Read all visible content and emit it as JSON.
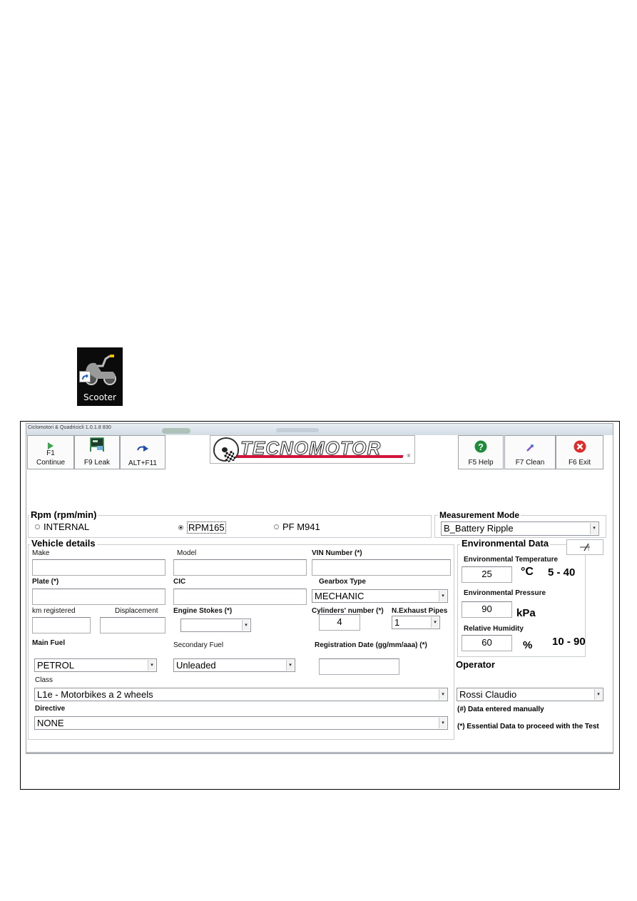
{
  "desktop": {
    "shortcut_label": "Scooter",
    "shortcut_icon": "scooter-icon"
  },
  "window": {
    "title": "Ciclomotori & Quadricicli 1.0.1.8  830"
  },
  "toolbar": {
    "continue": {
      "key": "F1",
      "label": "Continue",
      "icon": "play-icon"
    },
    "leak": {
      "label": "F9 Leak",
      "icon": "leak-test-icon"
    },
    "alt": {
      "label": "ALT+F11",
      "icon": "redo-arrow-icon"
    },
    "logo_text": "TECNOMOTOR",
    "help": {
      "label": "F5 Help",
      "icon": "help-icon"
    },
    "clean": {
      "label": "F7 Clean",
      "icon": "clean-icon"
    },
    "exit": {
      "label": "F6 Exit",
      "icon": "close-icon"
    }
  },
  "rpm": {
    "title": "Rpm (rpm/min)",
    "options": [
      "INTERNAL",
      "RPM165",
      "PF M941"
    ],
    "selected": "RPM165"
  },
  "measurement": {
    "title": "Measurement Mode",
    "value": "B_Battery Ripple"
  },
  "vehicle": {
    "title": "Vehicle details",
    "make_label": "Make",
    "make_value": "",
    "model_label": "Model",
    "model_value": "",
    "vin_label": "VIN Number (*)",
    "vin_value": "",
    "plate_label": "Plate (*)",
    "plate_value": "",
    "cic_label": "CIC",
    "cic_value": "",
    "gearbox_label": "Gearbox Type",
    "gearbox_value": "MECHANIC",
    "km_label": "km registered",
    "km_value": "",
    "displacement_label": "Displacement",
    "displacement_value": "",
    "strokes_label": "Engine Stokes (*)",
    "strokes_value": "",
    "cylinders_label": "Cylinders' number (*)",
    "cylinders_value": "4",
    "exhaust_label": "N.Exhaust Pipes",
    "exhaust_value": "1",
    "main_fuel_label": "Main Fuel",
    "main_fuel_value": "PETROL",
    "secondary_fuel_label": "Secondary Fuel",
    "secondary_fuel_value": "Unleaded",
    "reg_date_label": "Registration Date (gg/mm/aaa) (*)",
    "reg_date_value": "",
    "class_label": "Class",
    "class_value": "L1e - Motorbikes a 2 wheels",
    "directive_label": "Directive",
    "directive_value": "NONE"
  },
  "environment": {
    "title": "Environmental Data",
    "edit_icon": "edit-pen-icon",
    "temp_label": "Environmental Temperature",
    "temp_value": "25",
    "temp_unit": "°C",
    "temp_range": "5 - 40",
    "pressure_label": "Environmental Pressure",
    "pressure_value": "90",
    "pressure_unit": "kPa",
    "humidity_label": "Relative Humidity",
    "humidity_value": "60",
    "humidity_unit": "%",
    "humidity_range": "10 - 90"
  },
  "operator": {
    "title": "Operator",
    "value": "Rossi Claudio",
    "note_manual": "(#) Data entered manually",
    "note_essential": "(*) Essential Data to proceed with the Test"
  },
  "colors": {
    "accent_red": "#d2143a",
    "help_green": "#1e8a3a",
    "exit_red": "#e02b2b",
    "play_green": "#3aa84a",
    "border": "#9aa0a6"
  }
}
